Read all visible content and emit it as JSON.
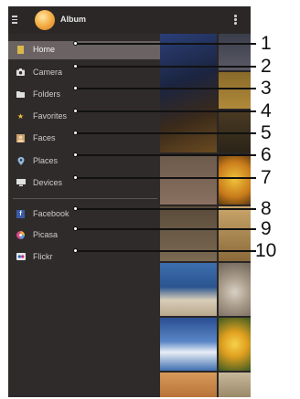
{
  "app": {
    "title": "Album"
  },
  "menu": {
    "items": [
      {
        "label": "Home",
        "icon": "home-icon",
        "active": true
      },
      {
        "label": "Camera",
        "icon": "camera-icon"
      },
      {
        "label": "Folders",
        "icon": "folder-icon"
      },
      {
        "label": "Favorites",
        "icon": "star-icon"
      },
      {
        "label": "Faces",
        "icon": "faces-icon"
      },
      {
        "label": "Places",
        "icon": "map-pin-icon"
      },
      {
        "label": "Devices",
        "icon": "devices-icon"
      }
    ],
    "online_items": [
      {
        "label": "Facebook",
        "icon": "facebook-icon"
      },
      {
        "label": "Picasa",
        "icon": "picasa-icon"
      },
      {
        "label": "Flickr",
        "icon": "flickr-icon"
      }
    ]
  },
  "callouts": [
    "1",
    "2",
    "3",
    "4",
    "5",
    "6",
    "7",
    "8",
    "9",
    "10"
  ],
  "colors": {
    "drawer_bg": "#302b2b",
    "active_item_bg": "#6b6363",
    "album_icon": "#f4b24a"
  }
}
